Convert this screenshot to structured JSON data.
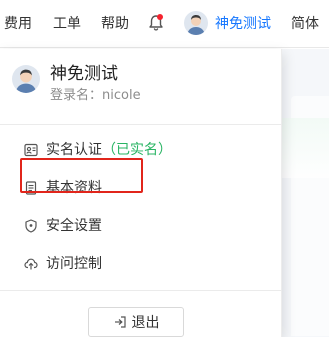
{
  "topbar": {
    "items": [
      {
        "label": "费用"
      },
      {
        "label": "工单"
      },
      {
        "label": "帮助"
      }
    ],
    "bell_icon": "bell-icon",
    "notification_dot_color": "#f5222d",
    "user_label": "神免测试",
    "language_label": "简体",
    "accent_color": "#1677ff"
  },
  "profile": {
    "name": "神免测试",
    "login": "登录名：nicole"
  },
  "menu": {
    "items": [
      {
        "label": "实名认证",
        "badge": "（已实名）",
        "icon": "id-card-icon"
      },
      {
        "label": "基本资料",
        "icon": "document-icon"
      },
      {
        "label": "安全设置",
        "icon": "shield-icon"
      },
      {
        "label": "访问控制",
        "icon": "cloud-upload-icon"
      }
    ],
    "badge_color": "#28b463",
    "highlight_color": "#e1251b"
  },
  "logout": {
    "label": "退出",
    "icon": "logout-icon"
  }
}
